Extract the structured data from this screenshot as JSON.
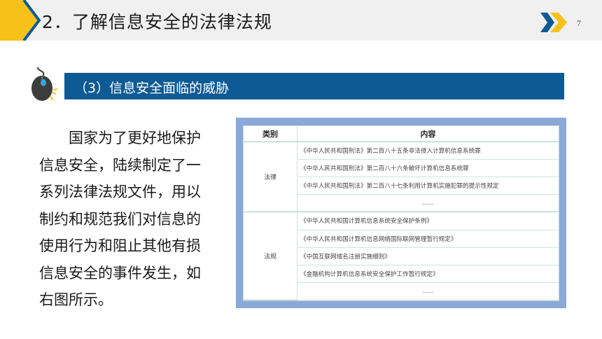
{
  "header": {
    "title": "2．了解信息安全的法律法规",
    "page_number": "7",
    "colors": {
      "accent_yellow": "#f6c21a",
      "accent_blue": "#0d5a94",
      "band": "#f0f0f0"
    }
  },
  "section": {
    "label": "（3）信息安全面临的威胁",
    "icon": "mouse-icon"
  },
  "paragraph": "国家为了更好地保护信息安全，陆续制定了一系列法律法规文件，用以制约和规范我们对信息的使用行为和阻止其他有损信息安全的事件发生，如右图所示。",
  "table": {
    "headers": {
      "category": "类别",
      "content": "内容"
    },
    "groups": [
      {
        "category": "法律",
        "items": [
          "《中华人民共和国刑法》第二百八十五条非法侵入计算机信息系统罪",
          "《中华人民共和国刑法》第二百八十六条破坏计算机信息系统罪",
          "《中华人民共和国刑法》第二百八十七条利用计算机实施犯罪的提示性规定",
          "……"
        ]
      },
      {
        "category": "法规",
        "items": [
          "《中华人民共和国计算机信息系统安全保护条例》",
          "《中华人民共和国计算机信息网络国际联网管理暂行规定》",
          "《中国互联网域名注册实施细则》",
          "《金融机构计算机信息系统安全保护工作暂行规定》",
          "……"
        ]
      }
    ]
  }
}
